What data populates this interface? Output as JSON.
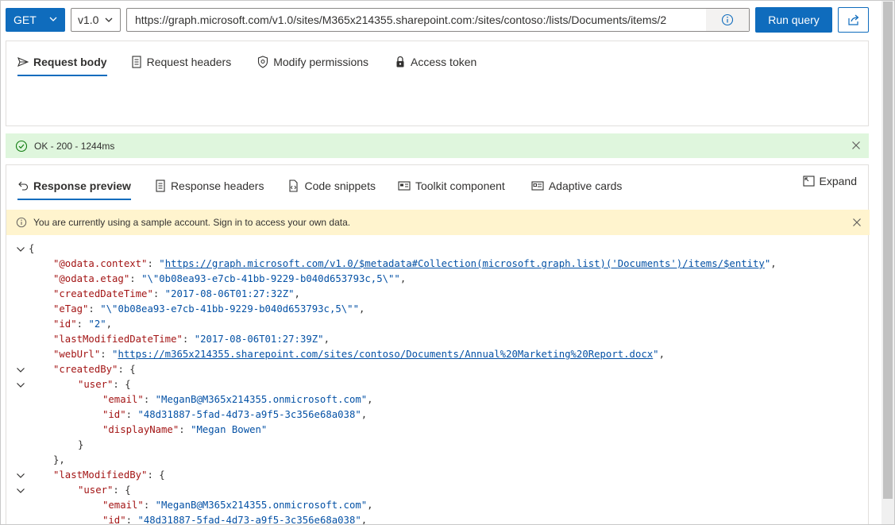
{
  "query": {
    "method": "GET",
    "version": "v1.0",
    "url": "https://graph.microsoft.com/v1.0/sites/M365x214355.sharepoint.com:/sites/contoso:/lists/Documents/items/2",
    "run_label": "Run query"
  },
  "request_tabs": [
    {
      "label": "Request body",
      "icon": "send-icon",
      "active": true
    },
    {
      "label": "Request headers",
      "icon": "document-icon",
      "active": false
    },
    {
      "label": "Modify permissions",
      "icon": "shield-icon",
      "active": false
    },
    {
      "label": "Access token",
      "icon": "lock-icon",
      "active": false
    }
  ],
  "status": {
    "text": "OK - 200 - 1244ms",
    "color": "#dff6dd"
  },
  "response_tabs": [
    {
      "label": "Response preview",
      "icon": "undo-icon",
      "active": true
    },
    {
      "label": "Response headers",
      "icon": "document-icon",
      "active": false
    },
    {
      "label": "Code snippets",
      "icon": "code-icon",
      "active": false
    },
    {
      "label": "Toolkit component",
      "icon": "toolkit-icon",
      "active": false
    },
    {
      "label": "Adaptive cards",
      "icon": "card-icon",
      "active": false
    }
  ],
  "expand_label": "Expand",
  "warning": {
    "text": "You are currently using a sample account. Sign in to access your own data.",
    "color": "#fff4ce"
  },
  "colors": {
    "accent": "#0f6cbd",
    "json_key": "#a31515",
    "json_string": "#0451a5"
  },
  "json_lines": [
    {
      "indent": 0,
      "fold": true,
      "parts": [
        {
          "t": "p",
          "v": "{"
        }
      ]
    },
    {
      "indent": 1,
      "fold": false,
      "parts": [
        {
          "t": "k",
          "v": "\"@odata.context\""
        },
        {
          "t": "p",
          "v": ": "
        },
        {
          "t": "s",
          "v": "\""
        },
        {
          "t": "lnk",
          "v": "https://graph.microsoft.com/v1.0/$metadata#Collection(microsoft.graph.list)('Documents')/items/$entity"
        },
        {
          "t": "s",
          "v": "\""
        },
        {
          "t": "p",
          "v": ","
        }
      ]
    },
    {
      "indent": 1,
      "fold": false,
      "parts": [
        {
          "t": "k",
          "v": "\"@odata.etag\""
        },
        {
          "t": "p",
          "v": ": "
        },
        {
          "t": "s",
          "v": "\"\\\"0b08ea93-e7cb-41bb-9229-b040d653793c,5\\\"\""
        },
        {
          "t": "p",
          "v": ","
        }
      ]
    },
    {
      "indent": 1,
      "fold": false,
      "parts": [
        {
          "t": "k",
          "v": "\"createdDateTime\""
        },
        {
          "t": "p",
          "v": ": "
        },
        {
          "t": "s",
          "v": "\"2017-08-06T01:27:32Z\""
        },
        {
          "t": "p",
          "v": ","
        }
      ]
    },
    {
      "indent": 1,
      "fold": false,
      "parts": [
        {
          "t": "k",
          "v": "\"eTag\""
        },
        {
          "t": "p",
          "v": ": "
        },
        {
          "t": "s",
          "v": "\"\\\"0b08ea93-e7cb-41bb-9229-b040d653793c,5\\\"\""
        },
        {
          "t": "p",
          "v": ","
        }
      ]
    },
    {
      "indent": 1,
      "fold": false,
      "parts": [
        {
          "t": "k",
          "v": "\"id\""
        },
        {
          "t": "p",
          "v": ": "
        },
        {
          "t": "s",
          "v": "\"2\""
        },
        {
          "t": "p",
          "v": ","
        }
      ]
    },
    {
      "indent": 1,
      "fold": false,
      "parts": [
        {
          "t": "k",
          "v": "\"lastModifiedDateTime\""
        },
        {
          "t": "p",
          "v": ": "
        },
        {
          "t": "s",
          "v": "\"2017-08-06T01:27:39Z\""
        },
        {
          "t": "p",
          "v": ","
        }
      ]
    },
    {
      "indent": 1,
      "fold": false,
      "parts": [
        {
          "t": "k",
          "v": "\"webUrl\""
        },
        {
          "t": "p",
          "v": ": "
        },
        {
          "t": "s",
          "v": "\""
        },
        {
          "t": "lnk",
          "v": "https://m365x214355.sharepoint.com/sites/contoso/Documents/Annual%20Marketing%20Report.docx"
        },
        {
          "t": "s",
          "v": "\""
        },
        {
          "t": "p",
          "v": ","
        }
      ]
    },
    {
      "indent": 1,
      "fold": true,
      "parts": [
        {
          "t": "k",
          "v": "\"createdBy\""
        },
        {
          "t": "p",
          "v": ": {"
        }
      ]
    },
    {
      "indent": 2,
      "fold": true,
      "parts": [
        {
          "t": "k",
          "v": "\"user\""
        },
        {
          "t": "p",
          "v": ": {"
        }
      ]
    },
    {
      "indent": 3,
      "fold": false,
      "parts": [
        {
          "t": "k",
          "v": "\"email\""
        },
        {
          "t": "p",
          "v": ": "
        },
        {
          "t": "s",
          "v": "\"MeganB@M365x214355.onmicrosoft.com\""
        },
        {
          "t": "p",
          "v": ","
        }
      ]
    },
    {
      "indent": 3,
      "fold": false,
      "parts": [
        {
          "t": "k",
          "v": "\"id\""
        },
        {
          "t": "p",
          "v": ": "
        },
        {
          "t": "s",
          "v": "\"48d31887-5fad-4d73-a9f5-3c356e68a038\""
        },
        {
          "t": "p",
          "v": ","
        }
      ]
    },
    {
      "indent": 3,
      "fold": false,
      "parts": [
        {
          "t": "k",
          "v": "\"displayName\""
        },
        {
          "t": "p",
          "v": ": "
        },
        {
          "t": "s",
          "v": "\"Megan Bowen\""
        }
      ]
    },
    {
      "indent": 2,
      "fold": false,
      "parts": [
        {
          "t": "p",
          "v": "}"
        }
      ]
    },
    {
      "indent": 1,
      "fold": false,
      "parts": [
        {
          "t": "p",
          "v": "},"
        }
      ]
    },
    {
      "indent": 1,
      "fold": true,
      "parts": [
        {
          "t": "k",
          "v": "\"lastModifiedBy\""
        },
        {
          "t": "p",
          "v": ": {"
        }
      ]
    },
    {
      "indent": 2,
      "fold": true,
      "parts": [
        {
          "t": "k",
          "v": "\"user\""
        },
        {
          "t": "p",
          "v": ": {"
        }
      ]
    },
    {
      "indent": 3,
      "fold": false,
      "parts": [
        {
          "t": "k",
          "v": "\"email\""
        },
        {
          "t": "p",
          "v": ": "
        },
        {
          "t": "s",
          "v": "\"MeganB@M365x214355.onmicrosoft.com\""
        },
        {
          "t": "p",
          "v": ","
        }
      ]
    },
    {
      "indent": 3,
      "fold": false,
      "parts": [
        {
          "t": "k",
          "v": "\"id\""
        },
        {
          "t": "p",
          "v": ": "
        },
        {
          "t": "s",
          "v": "\"48d31887-5fad-4d73-a9f5-3c356e68a038\""
        },
        {
          "t": "p",
          "v": ","
        }
      ]
    }
  ]
}
